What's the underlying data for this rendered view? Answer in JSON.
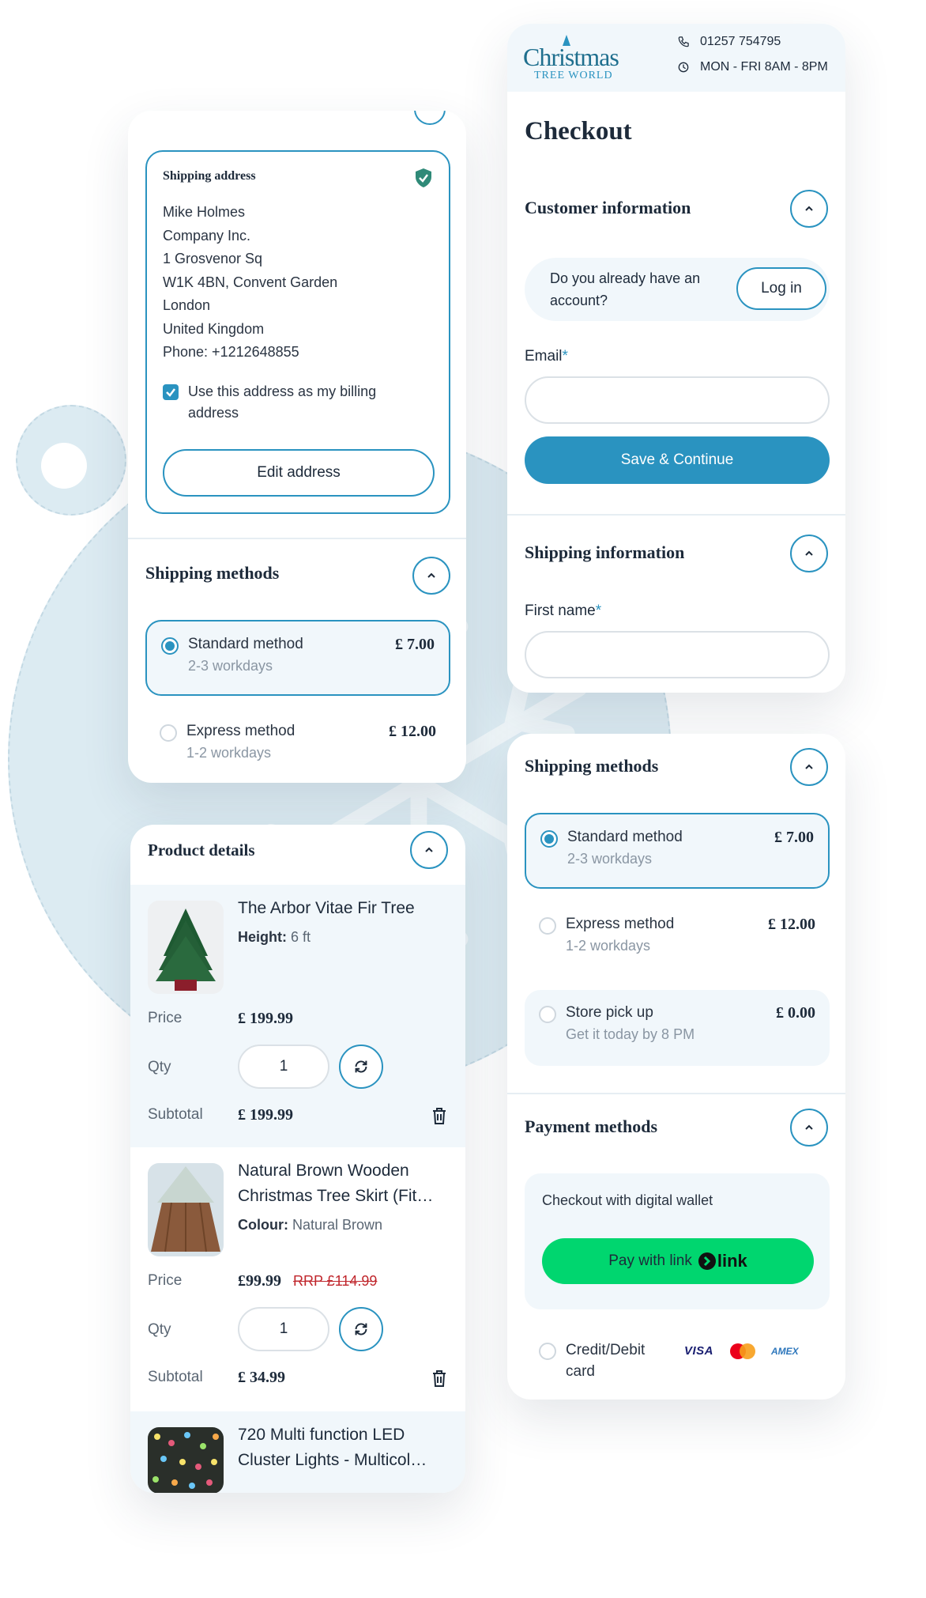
{
  "brand": {
    "logo_main": "Christmas",
    "logo_sub": "TREE WORLD",
    "phone": "01257 754795",
    "hours": "MON - FRI 8AM - 8PM"
  },
  "checkout": {
    "title": "Checkout",
    "customer_info": {
      "title": "Customer information",
      "login_prompt": "Do you already have an account?",
      "login_button": "Log in",
      "email_label": "Email",
      "required_mark": "*",
      "email_value": "",
      "save_button": "Save & Continue"
    },
    "shipping_info": {
      "title": "Shipping information",
      "first_name_label": "First name",
      "required_mark": "*",
      "first_name_value": ""
    },
    "shipping_methods": {
      "title": "Shipping methods",
      "options": [
        {
          "name": "Standard method",
          "sub": "2-3 workdays",
          "price": "£ 7.00",
          "selected": true
        },
        {
          "name": "Express method",
          "sub": "1-2 workdays",
          "price": "£ 12.00",
          "selected": false
        },
        {
          "name": "Store pick up",
          "sub": "Get it today by 8 PM",
          "price": "£ 0.00",
          "selected": false
        }
      ]
    },
    "payment_methods": {
      "title": "Payment methods",
      "wallet_label": "Checkout with digital wallet",
      "pay_button": "Pay with link",
      "pay_brand": "link",
      "card_label_1": "Credit/Debit",
      "card_label_2": "card",
      "card_brands": [
        "VISA",
        "AMEX"
      ]
    }
  },
  "left": {
    "shipping_address": {
      "title": "Shipping address",
      "lines": [
        "Mike Holmes",
        "Company Inc.",
        "1 Grosvenor Sq",
        "W1K 4BN, Convent Garden",
        "London",
        "United Kingdom",
        "Phone: +1212648855"
      ],
      "billing_checkbox": "Use this address as my billing address",
      "billing_checked": true,
      "edit_button": "Edit address"
    },
    "shipping_methods": {
      "title": "Shipping methods",
      "options": [
        {
          "name": "Standard method",
          "sub": "2-3 workdays",
          "price": "£ 7.00",
          "selected": true
        },
        {
          "name": "Express method",
          "sub": "1-2 workdays",
          "price": "£ 12.00",
          "selected": false
        }
      ]
    }
  },
  "product_details": {
    "title": "Product details",
    "labels": {
      "price": "Price",
      "qty": "Qty",
      "subtotal": "Subtotal"
    },
    "items": [
      {
        "name": "The Arbor Vitae Fir Tree",
        "attr_label": "Height:",
        "attr_value": "6 ft",
        "price": "£ 199.99",
        "rrp": "",
        "qty": "1",
        "subtotal": "£ 199.99"
      },
      {
        "name": "Natural Brown Wooden Christmas Tree Skirt (Fit…",
        "attr_label": "Colour:",
        "attr_value": "Natural Brown",
        "price": "£99.99",
        "rrp": "RRP £114.99",
        "qty": "1",
        "subtotal": "£ 34.99"
      },
      {
        "name": "720 Multi function LED Cluster Lights - Multicol…"
      }
    ]
  },
  "colors": {
    "accent": "#2a93c0",
    "link_green": "#00d66f",
    "rrp_red": "#c0272d"
  }
}
